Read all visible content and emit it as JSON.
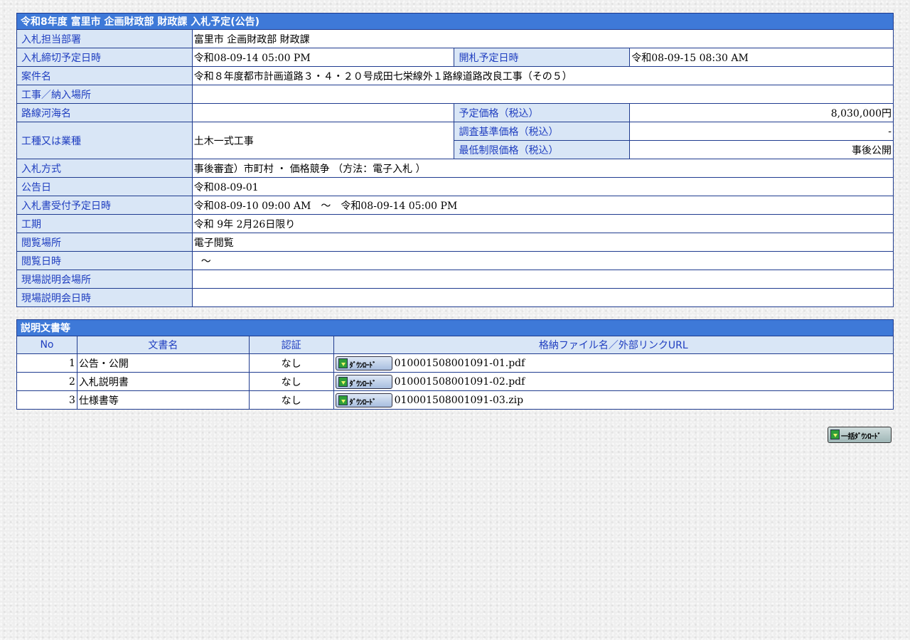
{
  "title": "令和8年度 富里市 企画財政部 財政課 入札予定(公告)",
  "info": {
    "dept_label": "入札担当部署",
    "dept_value": "富里市 企画財政部 財政課",
    "deadline_label": "入札締切予定日時",
    "deadline_value": "令和08-09-14 05:00 PM",
    "opening_label": "開札予定日時",
    "opening_value": "令和08-09-15 08:30 AM",
    "case_label": "案件名",
    "case_value": "令和８年度都市計画道路３・４・２０号成田七栄線外１路線道路改良工事（その５）",
    "place_label": "工事／納入場所",
    "place_value": "",
    "route_label": "路線河海名",
    "route_value": "",
    "estimated_label": "予定価格（税込）",
    "estimated_value": "8,030,000円",
    "work_label": "工種又は業種",
    "work_value": "土木一式工事",
    "survey_label": "調査基準価格（税込）",
    "survey_value": "-",
    "minimum_label": "最低制限価格（税込）",
    "minimum_value": "事後公開",
    "method_label": "入札方式",
    "method_value": "事後審査）市町村 ・ 価格競争 （方法：電子入札 ）",
    "notice_label": "公告日",
    "notice_value": "令和08-09-01",
    "receipt_label": "入札書受付予定日時",
    "receipt_value": "令和08-09-10 09:00 AM　～　令和08-09-14 05:00 PM",
    "period_label": "工期",
    "period_value": "令和 9年 2月26日限り",
    "view_place_label": "閲覧場所",
    "view_place_value": "電子閲覧",
    "view_date_label": "閲覧日時",
    "view_date_value": "～",
    "site_place_label": "現場説明会場所",
    "site_place_value": "",
    "site_date_label": "現場説明会日時",
    "site_date_value": ""
  },
  "docs": {
    "title": "説明文書等",
    "headers": {
      "no": "No",
      "name": "文書名",
      "auth": "認証",
      "file": "格納ファイル名／外部リンクURL"
    },
    "download_label": "ﾀﾞｳﾝﾛｰﾄﾞ",
    "rows": [
      {
        "no": "1",
        "name": "公告・公開",
        "auth": "なし",
        "file": "010001508001091-01.pdf"
      },
      {
        "no": "2",
        "name": "入札説明書",
        "auth": "なし",
        "file": "010001508001091-02.pdf"
      },
      {
        "no": "3",
        "name": "仕様書等",
        "auth": "なし",
        "file": "010001508001091-03.zip"
      }
    ]
  },
  "bulk_download_label": "一括ﾀﾞｳﾝﾛｰﾄﾞ"
}
